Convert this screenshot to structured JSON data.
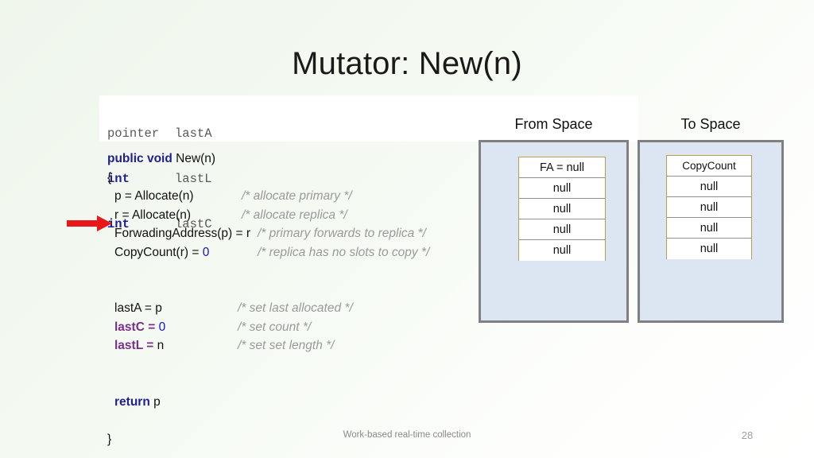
{
  "slide": {
    "title": "Mutator: New(n)",
    "footer": "Work-based real-time collection",
    "page_number": "28"
  },
  "declarations": [
    {
      "type": "pointer",
      "name": "lastA",
      "type_is_keyword": false
    },
    {
      "type": "int",
      "name": "lastL",
      "type_is_keyword": true
    },
    {
      "type": "int",
      "name": "lastC",
      "type_is_keyword": true
    }
  ],
  "method": {
    "signature_keywords": "public void",
    "signature_name": "New(n)",
    "open_brace": "{",
    "close_brace": "}",
    "return_keyword": "return",
    "return_value": "p",
    "body": [
      {
        "stmt": "p = Allocate(n)",
        "comment": "/* allocate primary */"
      },
      {
        "stmt": "r = Allocate(n)",
        "comment": "/* allocate replica */"
      },
      {
        "stmt": "ForwadingAddress(p)  = r",
        "comment": "/* primary forwards to replica */"
      },
      {
        "stmt_prefix": "CopyCount(r)  = ",
        "stmt_value": "0",
        "comment": "/* replica has no slots to copy */"
      }
    ],
    "assignments": [
      {
        "name": "lastA",
        "highlight": false,
        "op": " = ",
        "value": "p",
        "comment": "/* set last allocated */"
      },
      {
        "name": "lastC",
        "highlight": true,
        "op": " = ",
        "value": "0",
        "value_is_number": true,
        "comment": "/* set count */"
      },
      {
        "name": "lastL",
        "highlight": true,
        "op": " = ",
        "value": "n",
        "comment": "/* set set length */"
      }
    ]
  },
  "diagram": {
    "from_space": {
      "label": "From Space",
      "cells": [
        "FA = null",
        "null",
        "null",
        "null",
        "null"
      ]
    },
    "to_space": {
      "label": "To Space",
      "cells": [
        "CopyCount",
        "null",
        "null",
        "null",
        "null"
      ]
    }
  },
  "colors": {
    "keyword_blue": "#1f1f8f",
    "keyword_purple": "#7b2f8c",
    "number_blue": "#1414c8",
    "comment_gray": "#9a9a9a",
    "arrow_red": "#e8171a",
    "space_fill": "#dce6f2",
    "space_border": "#808080",
    "cell_border_gold": "#bf9f4f"
  },
  "icons": {
    "arrow": "right-arrow-icon"
  }
}
